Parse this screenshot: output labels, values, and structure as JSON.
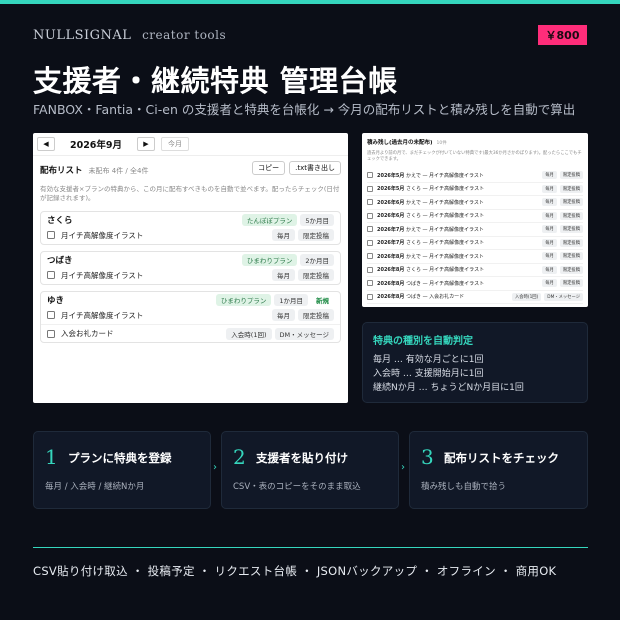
{
  "brand": {
    "name": "NULLSIGNAL",
    "sub": "creator tools"
  },
  "price": "￥800",
  "headline": "支援者・継続特典 管理台帳",
  "subline": "FANBOX・Fantia・Ci-en の支援者と特典を台帳化 → 今月の配布リストと積み残しを自動で算出",
  "main": {
    "month": "2026年9月",
    "today": "今月",
    "prev": "◀",
    "next": "▶",
    "title": "配布リスト",
    "meta": "未配布 4件 / 全4件",
    "copy": "コピー",
    "txt": ".txt書き出し",
    "desc": "有効な支援者×プランの特典から、この月に配布すべきものを自動で並べます。配ったらチェック(日付が記録されます)。",
    "cards": [
      {
        "name": "さくら",
        "tags": [
          "たんぽぽプラン",
          "5か月目"
        ],
        "rows": [
          {
            "text": "月イチ高解像度イラスト",
            "tags": [
              "毎月",
              "限定投稿"
            ]
          }
        ]
      },
      {
        "name": "つばき",
        "tags": [
          "ひまわりプラン",
          "2か月目"
        ],
        "rows": [
          {
            "text": "月イチ高解像度イラスト",
            "tags": [
              "毎月",
              "限定投稿"
            ]
          }
        ]
      },
      {
        "name": "ゆき",
        "tags": [
          "ひまわりプラン",
          "1か月目",
          "新規"
        ],
        "rows": [
          {
            "text": "月イチ高解像度イラスト",
            "tags": [
              "毎月",
              "限定投稿"
            ]
          },
          {
            "text": "入会お礼カード",
            "tags": [
              "入会時(1回)",
              "DM・メッセージ"
            ]
          }
        ]
      }
    ]
  },
  "backlog": {
    "title": "積み残し(過去月の未配布)",
    "count": "10件",
    "desc": "過去月より前の月で、まだチェックが付いていない特典です(最大36か月さかのぼります)。配ったらここでもチェックできます。",
    "rows": [
      {
        "date": "2026年5月",
        "text": "かえで — 月イチ高解像度イラスト",
        "tags": [
          "毎月",
          "限定投稿"
        ]
      },
      {
        "date": "2026年5月",
        "text": "さくら — 月イチ高解像度イラスト",
        "tags": [
          "毎月",
          "限定投稿"
        ]
      },
      {
        "date": "2026年6月",
        "text": "かえで — 月イチ高解像度イラスト",
        "tags": [
          "毎月",
          "限定投稿"
        ]
      },
      {
        "date": "2026年6月",
        "text": "さくら — 月イチ高解像度イラスト",
        "tags": [
          "毎月",
          "限定投稿"
        ]
      },
      {
        "date": "2026年7月",
        "text": "かえで — 月イチ高解像度イラスト",
        "tags": [
          "毎月",
          "限定投稿"
        ]
      },
      {
        "date": "2026年7月",
        "text": "さくら — 月イチ高解像度イラスト",
        "tags": [
          "毎月",
          "限定投稿"
        ]
      },
      {
        "date": "2026年8月",
        "text": "かえで — 月イチ高解像度イラスト",
        "tags": [
          "毎月",
          "限定投稿"
        ]
      },
      {
        "date": "2026年8月",
        "text": "さくら — 月イチ高解像度イラスト",
        "tags": [
          "毎月",
          "限定投稿"
        ]
      },
      {
        "date": "2026年8月",
        "text": "つばき — 月イチ高解像度イラスト",
        "tags": [
          "毎月",
          "限定投稿"
        ]
      },
      {
        "date": "2026年8月",
        "text": "つばき — 入会お礼カード",
        "tags": [
          "入会時(1回)",
          "DM・メッセージ"
        ]
      }
    ]
  },
  "info": {
    "title": "特典の種別を自動判定",
    "lines": [
      "毎月 … 有効な月ごとに1回",
      "入会時 … 支援開始月に1回",
      "継続Nか月 … ちょうどNか月目に1回"
    ]
  },
  "steps": [
    {
      "num": "1",
      "title": "プランに特典を登録",
      "desc": "毎月 / 入会時 / 継続Nか月"
    },
    {
      "num": "2",
      "title": "支援者を貼り付け",
      "desc": "CSV・表のコピーをそのまま取込"
    },
    {
      "num": "3",
      "title": "配布リストをチェック",
      "desc": "積み残しも自動で拾う"
    }
  ],
  "arrow": "›",
  "footer": "CSV貼り付け取込 ・ 投稿予定 ・ リクエスト台帳 ・ JSONバックアップ ・ オフライン ・ 商用OK",
  "colors": {
    "accent": "#35d6bd",
    "price": "#ff2d7a",
    "bg": "#0b0e17"
  },
  "icons": {
    "prev": "chevron-left-icon",
    "next": "chevron-right-icon",
    "checkbox": "checkbox-icon"
  }
}
